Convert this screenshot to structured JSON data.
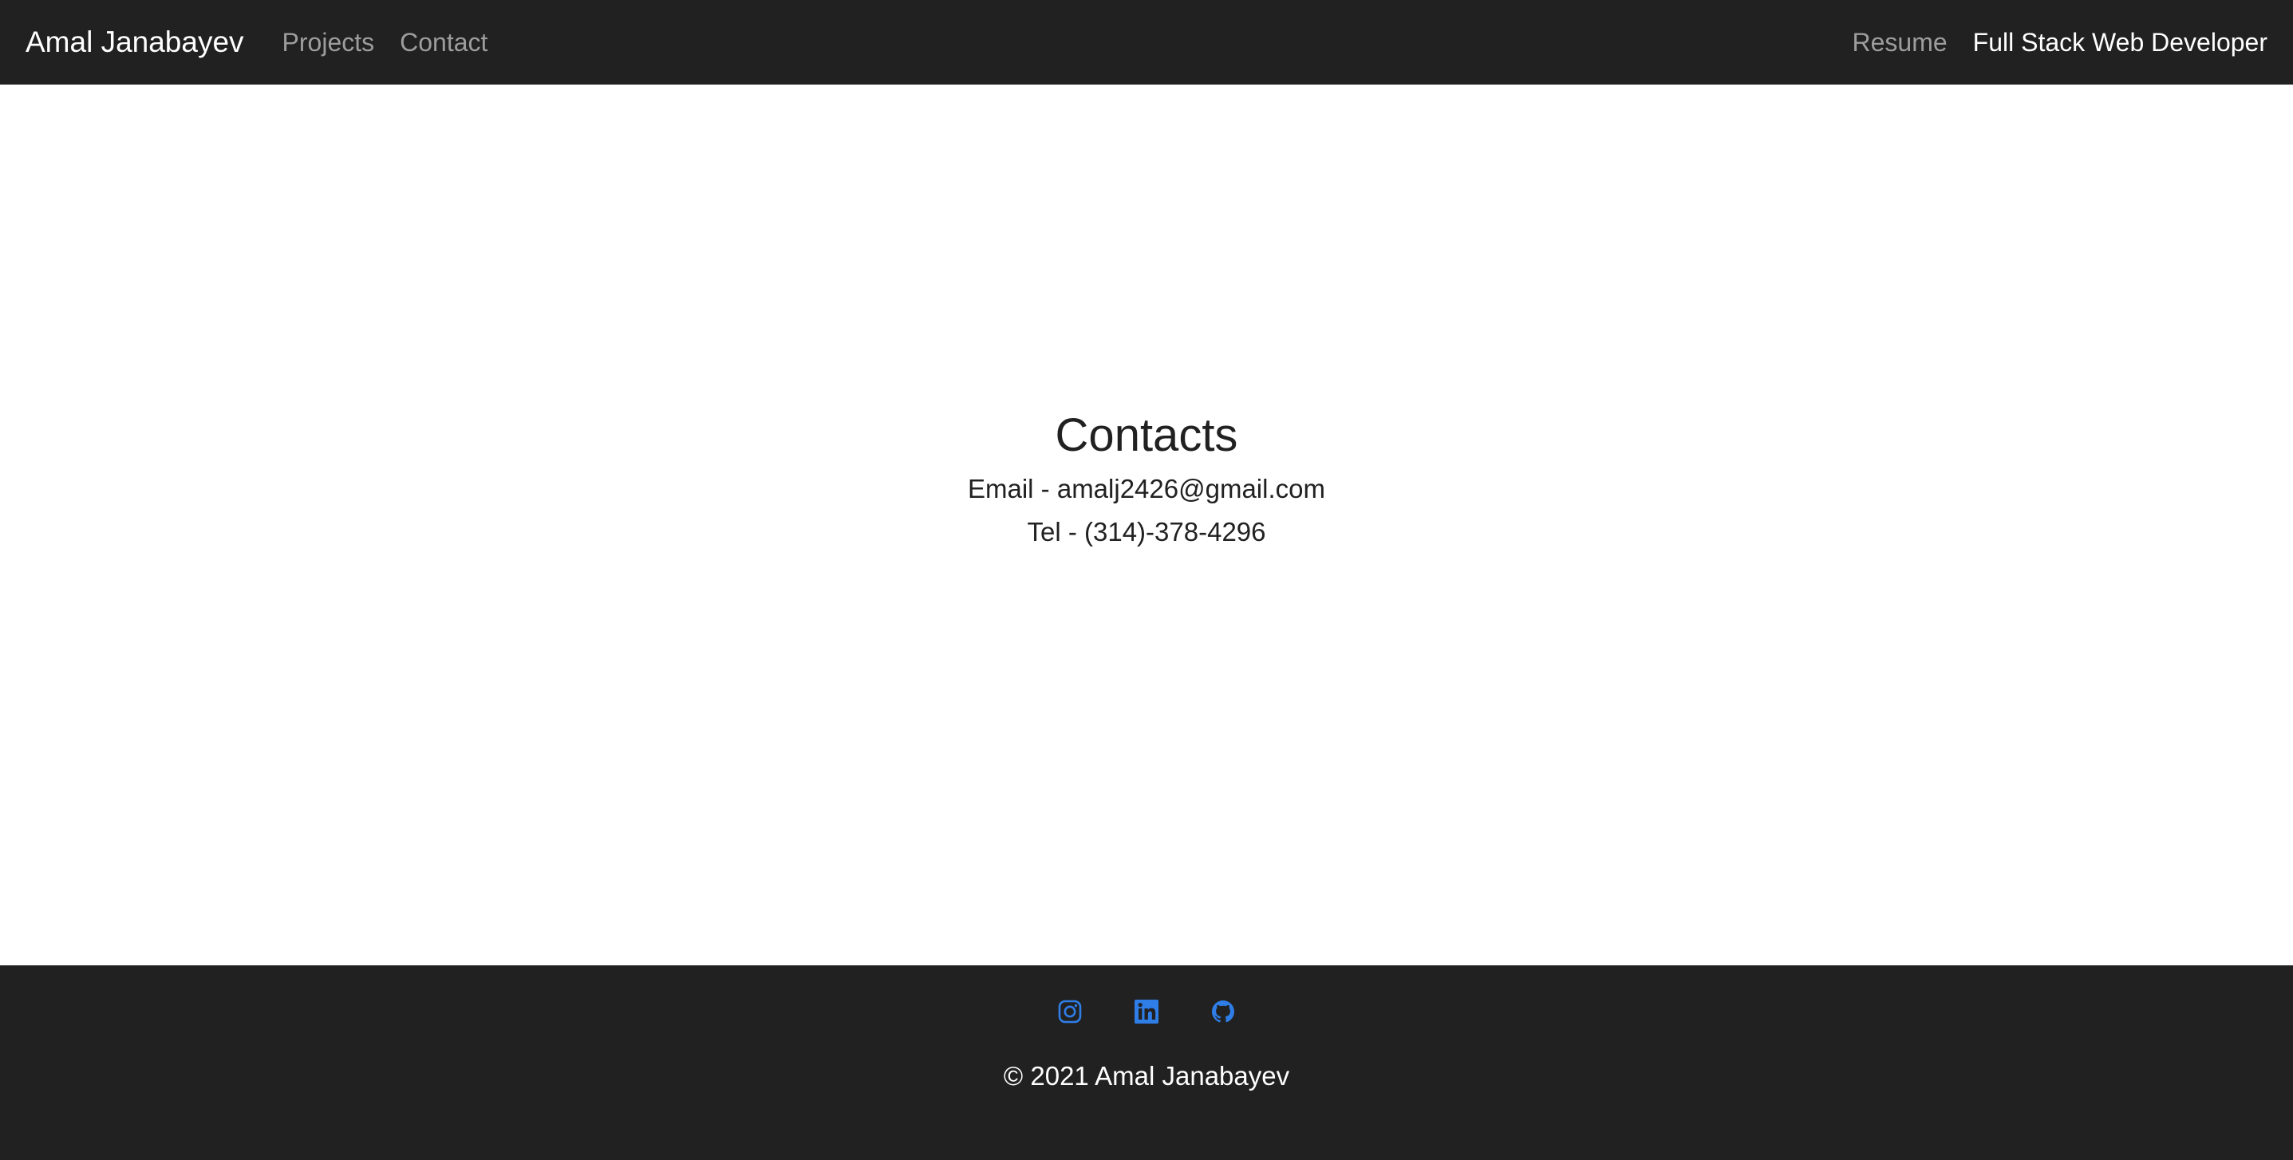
{
  "navbar": {
    "brand": "Amal Janabayev",
    "links": [
      {
        "label": "Projects"
      },
      {
        "label": "Contact"
      }
    ],
    "right_link": "Resume",
    "tagline": "Full Stack Web Developer"
  },
  "contacts": {
    "title": "Contacts",
    "email": "Email - amalj2426@gmail.com",
    "tel": "Tel - (314)-378-4296"
  },
  "footer": {
    "social": [
      {
        "icon": "instagram-icon"
      },
      {
        "icon": "linkedin-icon"
      },
      {
        "icon": "github-icon"
      }
    ],
    "copyright": "© 2021 Amal Janabayev"
  },
  "colors": {
    "dark": "#212121",
    "nav_muted": "#9d9d9d",
    "icon_blue": "#2f7ee8",
    "text": "#212121"
  }
}
